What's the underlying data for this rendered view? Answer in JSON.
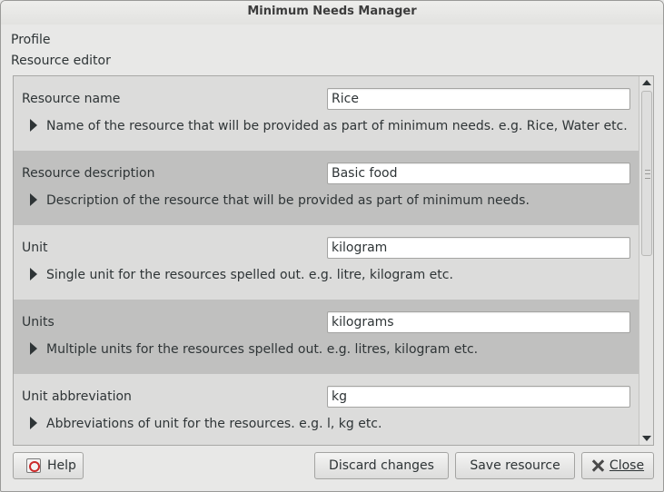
{
  "window": {
    "title": "Minimum Needs Manager"
  },
  "breadcrumbs": {
    "profile": "Profile",
    "resource_editor": "Resource editor"
  },
  "fields": [
    {
      "label": "Resource name",
      "value": "Rice",
      "hint": "Name of the resource that will be provided as part of minimum needs. e.g. Rice, Water etc."
    },
    {
      "label": "Resource description",
      "value": "Basic food",
      "hint": "Description of the resource that will be provided as part of minimum needs."
    },
    {
      "label": "Unit",
      "value": "kilogram",
      "hint": "Single unit for the resources spelled out. e.g. litre, kilogram etc."
    },
    {
      "label": "Units",
      "value": "kilograms",
      "hint": "Multiple units for the resources spelled out. e.g. litres, kilogram etc."
    },
    {
      "label": "Unit abbreviation",
      "value": "kg",
      "hint": "Abbreviations of unit for the resources. e.g. l, kg etc."
    }
  ],
  "buttons": {
    "help": "Help",
    "discard": "Discard changes",
    "save": "Save resource",
    "close": "Close"
  },
  "icons": {
    "help": "help-icon",
    "close": "close-icon",
    "expand": "triangle-right-icon"
  }
}
